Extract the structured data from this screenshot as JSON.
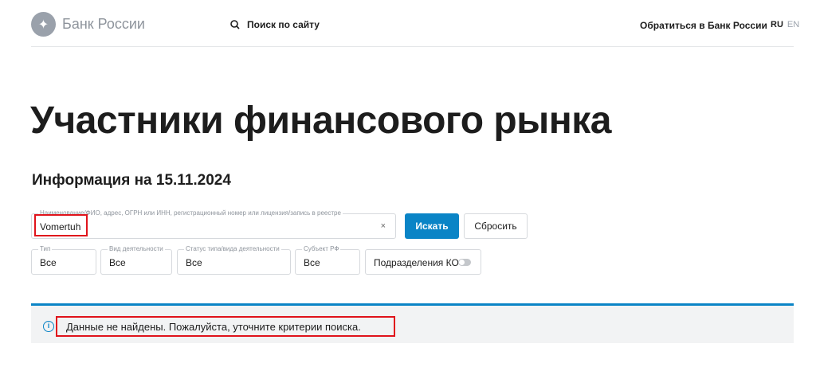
{
  "header": {
    "logo_text": "Банк России",
    "search_label": "Поиск по сайту",
    "contact_label": "Обратиться в Банк России",
    "lang_ru": "RU",
    "lang_en": "EN"
  },
  "page": {
    "title": "Участники финансового рынка",
    "info_date": "Информация на 15.11.2024"
  },
  "form": {
    "main_label": "Наименование/ФИО, адрес, ОГРН или ИНН, регистрационный номер или лицензия/запись в реестре",
    "main_value": "Vomertuh",
    "clear": "×",
    "search_button": "Искать",
    "reset_button": "Сбросить",
    "filters": [
      {
        "label": "Тип",
        "value": "Все"
      },
      {
        "label": "Вид деятельности",
        "value": "Все"
      },
      {
        "label": "Статус типа/вида деятельности",
        "value": "Все"
      },
      {
        "label": "Субъект РФ",
        "value": "Все"
      }
    ],
    "toggle_label": "Подразделения КО"
  },
  "alert": {
    "text": "Данные не найдены. Пожалуйста, уточните критерии поиска.",
    "icon": "i"
  }
}
